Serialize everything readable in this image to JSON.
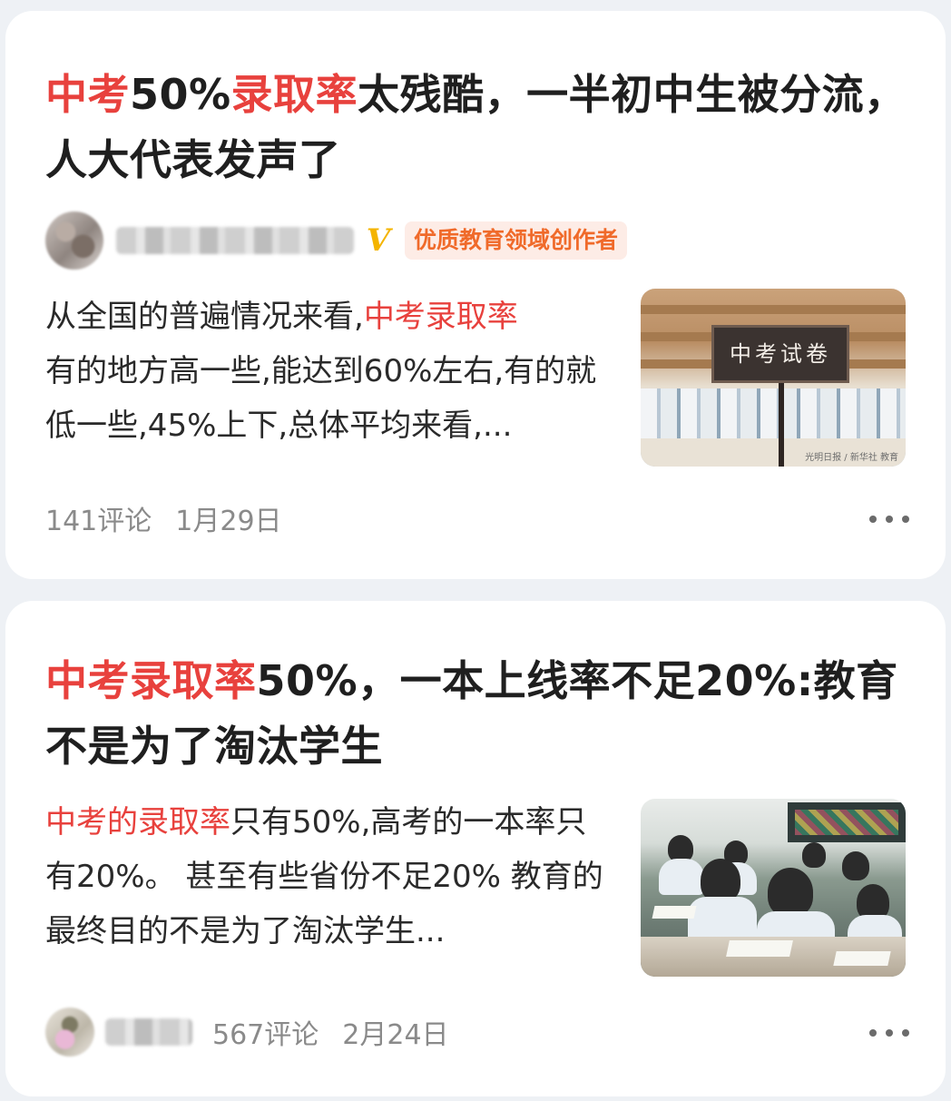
{
  "articles": [
    {
      "title_parts": [
        {
          "text": "中考",
          "highlight": true
        },
        {
          "text": "50%",
          "highlight": false
        },
        {
          "text": "录取率",
          "highlight": true
        },
        {
          "text": "太残酷，一半初中生被分流，人大代表发声了",
          "highlight": false
        }
      ],
      "author_badge": "V",
      "creator_tag": "优质教育领域创作者",
      "summary_parts": [
        {
          "text": "从全国的普遍情况来看,",
          "highlight": false
        },
        {
          "text": "中考录取率",
          "highlight": true
        },
        {
          "text": "有的地方高一些,能达到60%左右,有的就低一些,45%上下,总体平均来看,...",
          "highlight": false
        }
      ],
      "thumbnail": {
        "sign_text": "中考试卷",
        "caption": "光明日报 / 新华社 教育"
      },
      "comments": "141评论",
      "date": "1月29日",
      "more_icon": "more-icon"
    },
    {
      "title_parts": [
        {
          "text": "中考录取率",
          "highlight": true
        },
        {
          "text": "50%，一本上线率不足20%:教育不是为了淘汰学生",
          "highlight": false
        }
      ],
      "summary_parts": [
        {
          "text": "中考的录取率",
          "highlight": true
        },
        {
          "text": "只有50%,高考的一本率只有20%。 甚至有些省份不足20% 教育的最终目的不是为了淘汰学生...",
          "highlight": false
        }
      ],
      "comments": "567评论",
      "date": "2月24日",
      "more_icon": "more-icon"
    }
  ],
  "colors": {
    "highlight": "#e8413d",
    "creator_tag_text": "#f06a2a",
    "creator_tag_bg": "#fdece6",
    "verified_badge": "#f4b400",
    "meta_text": "#8a8a8a"
  }
}
